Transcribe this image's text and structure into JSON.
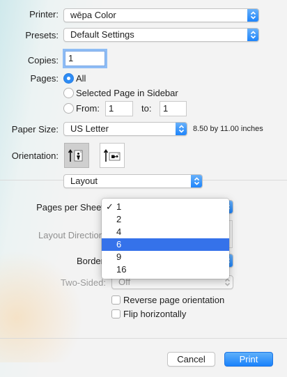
{
  "printer": {
    "label": "Printer:",
    "value": "wēpa Color"
  },
  "presets": {
    "label": "Presets:",
    "value": "Default Settings"
  },
  "copies": {
    "label": "Copies:",
    "value": "1"
  },
  "pages": {
    "label": "Pages:",
    "all": "All",
    "selected": "Selected Page in Sidebar",
    "from_label": "From:",
    "from_value": "1",
    "to_label": "to:",
    "to_value": "1"
  },
  "paper_size": {
    "label": "Paper Size:",
    "value": "US Letter",
    "dimensions": "8.50 by 11.00 inches"
  },
  "orientation": {
    "label": "Orientation:",
    "selected": "portrait"
  },
  "section_popup": {
    "value": "Layout"
  },
  "layout": {
    "pages_per_sheet_label": "Pages per Sheet",
    "layout_direction_label": "Layout Direction",
    "border_label": "Border",
    "two_sided_label": "Two-Sided:",
    "two_sided_value": "Off",
    "reverse_label": "Reverse page orientation",
    "flip_label": "Flip horizontally"
  },
  "pages_menu": {
    "options": [
      "1",
      "2",
      "4",
      "6",
      "9",
      "16"
    ],
    "checked": "1",
    "highlighted": "6",
    "check_glyph": "✓"
  },
  "buttons": {
    "cancel": "Cancel",
    "print": "Print"
  },
  "colors": {
    "accent": "#1a82fb",
    "highlight": "#3572ea"
  }
}
